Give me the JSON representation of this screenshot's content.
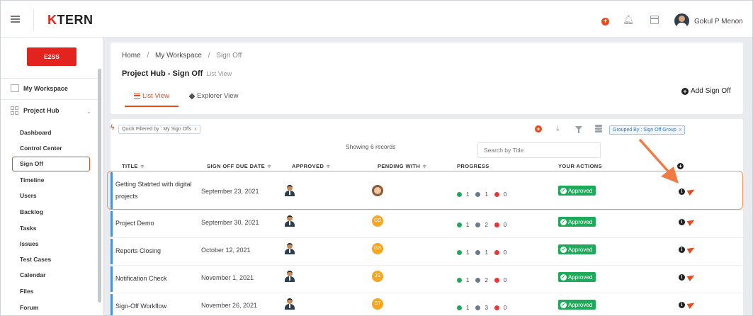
{
  "topbar": {
    "logo_k": "K",
    "logo_rest": "TERN",
    "user_name": "Gokul P Menon"
  },
  "sidebar": {
    "org_button": "E2SS",
    "my_workspace": "My Workspace",
    "project_hub": "Project Hub",
    "sub_items": [
      "Dashboard",
      "Control Center",
      "Sign Off",
      "Timeline",
      "Users",
      "Backlog",
      "Tasks",
      "Issues",
      "Test Cases",
      "Calendar",
      "Files",
      "Forum"
    ],
    "active_item": "Sign Off"
  },
  "header": {
    "breadcrumb": [
      "Home",
      "My Workspace",
      "Sign Off"
    ],
    "breadcrumb_sep": "/",
    "title": "Project Hub - Sign Off",
    "title_sub": "List View",
    "tabs": [
      {
        "label": "List View",
        "active": true
      },
      {
        "label": "Explorer View",
        "active": false
      }
    ],
    "add_button": "Add Sign Off"
  },
  "toolbar": {
    "quick_filter": "Quick Filtered by : My Sign Offs",
    "grouped_by": "Grouped By : Sign Off Group",
    "chip_close": "x",
    "records": "Showing 6 records",
    "search_placeholder": "Search by Title"
  },
  "table": {
    "columns": [
      "Title",
      "Sign Off Due Date",
      "Approved",
      "Pending With",
      "Progress",
      "Your Actions"
    ],
    "sort_glyph": "≑",
    "rows": [
      {
        "title": "Getting Statrted with digital projects",
        "due": "September 23, 2021",
        "pending": "",
        "pending_photo": true,
        "p_green": "1",
        "p_grey": "1",
        "p_red": "0",
        "action": "Approved"
      },
      {
        "title": "Project Demo",
        "due": "September 30, 2021",
        "pending": "GS",
        "pending_photo": false,
        "p_green": "1",
        "p_grey": "2",
        "p_red": "0",
        "action": "Approved"
      },
      {
        "title": "Reports Closing",
        "due": "October 12, 2021",
        "pending": "GS",
        "pending_photo": false,
        "p_green": "1",
        "p_grey": "1",
        "p_red": "0",
        "action": "Approved"
      },
      {
        "title": "Notification Check",
        "due": "November 1, 2021",
        "pending": "JS",
        "pending_photo": false,
        "p_green": "1",
        "p_grey": "2",
        "p_red": "0",
        "action": "Approved"
      },
      {
        "title": "Sign-Off Workflow",
        "due": "November 26, 2021",
        "pending": "ST",
        "pending_photo": false,
        "p_green": "1",
        "p_grey": "3",
        "p_red": "0",
        "action": "Approved"
      }
    ]
  },
  "colors": {
    "accent": "#e8491d",
    "brand_red": "#e3231d",
    "approved_green": "#1eaa5a",
    "row_bar_blue": "#4a90e2",
    "highlight": "#f0945c"
  }
}
